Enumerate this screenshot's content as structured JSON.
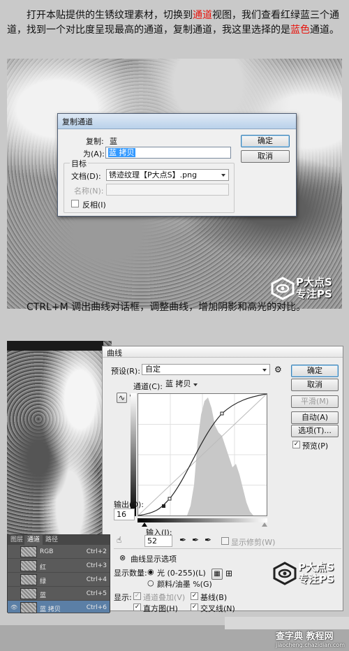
{
  "intro": {
    "part1": "打开本贴提供的生锈纹理素材，切换到",
    "channels_word": "通道",
    "part2": "视图，我们查看红绿蓝三个通道，找到一个对比度呈现最高的通道，复制通道，我这里选择的是",
    "blue_word": "蓝色",
    "part3": "通道。"
  },
  "dup_dialog": {
    "title": "复制通道",
    "copy_label": "复制:",
    "copy_value": "蓝",
    "as_label": "为(A):",
    "as_value": "蓝 拷贝",
    "target_label": "目标",
    "doc_label": "文档(D):",
    "doc_value": "锈迹纹理【P大点S】.png",
    "name_label": "名称(N):",
    "name_value": "",
    "invert_label": "反相(I)",
    "ok": "确定",
    "cancel": "取消"
  },
  "step2": "CTRL+M 调出曲线对话框，调整曲线，增加阴影和高光的对比。",
  "logo": {
    "line1": "P大点S",
    "line2": "专注PS"
  },
  "curves": {
    "title": "曲线",
    "preset_label": "预设(R):",
    "preset_value": "自定",
    "channel_label": "通道(C):",
    "channel_value": "蓝 拷贝",
    "ok": "确定",
    "cancel": "取消",
    "smooth": "平滑(M)",
    "auto": "自动(A)",
    "options": "选项(T)...",
    "preview": "预览(P)",
    "output_label": "输出(O):",
    "output_value": "16",
    "input_label": "输入(I):",
    "input_value": "52",
    "show_clipping": "显示修剪(W)",
    "display_options": "曲线显示选项",
    "show_amount": "显示数量:",
    "light": "光 (0-255)(L)",
    "pigment": "颜料/油墨 %(G)",
    "show": "显示:",
    "channel_overlays": "通道叠加(V)",
    "baseline": "基线(B)",
    "histogram": "直方图(H)",
    "intersection": "交叉线(N)"
  },
  "channels_panel": {
    "tabs": [
      "图层",
      "通道",
      "路径"
    ],
    "rows": [
      {
        "name": "RGB",
        "shortcut": "Ctrl+2"
      },
      {
        "name": "红",
        "shortcut": "Ctrl+3"
      },
      {
        "name": "绿",
        "shortcut": "Ctrl+4"
      },
      {
        "name": "蓝",
        "shortcut": "Ctrl+5"
      },
      {
        "name": "蓝 拷贝",
        "shortcut": "Ctrl+6"
      }
    ]
  },
  "watermark": {
    "main": "查字典 教程网",
    "sub": "jiaocheng.chazidian.com"
  }
}
